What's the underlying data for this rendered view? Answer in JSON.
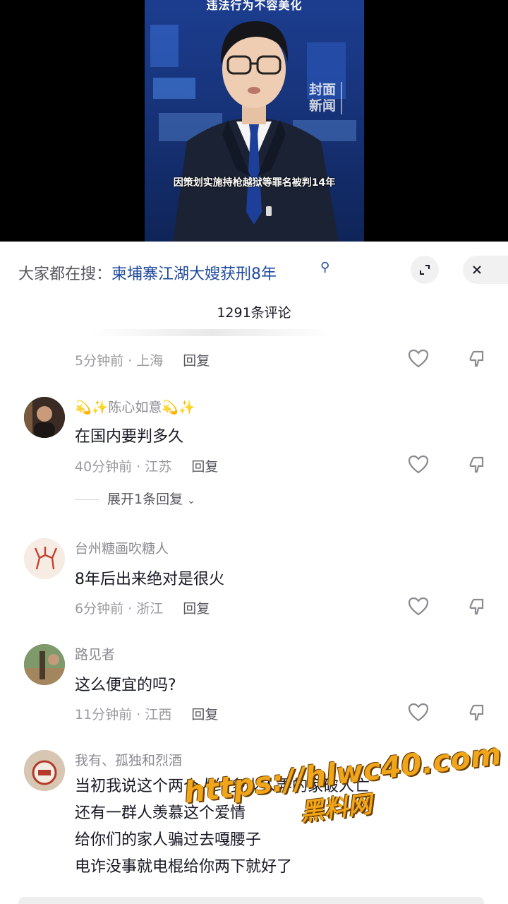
{
  "video": {
    "caption_top": "违法行为不容美化",
    "caption_bottom": "因策划实施持枪越狱等罪名被判14年",
    "logo_text": "封面新闻"
  },
  "search": {
    "prefix": "大家都在搜：",
    "query": "柬埔寨江湖大嫂获刑8年",
    "icon": "search-icon"
  },
  "header": {
    "comment_count": "1291条评论",
    "expand_icon": "expand-icon",
    "close_icon": "close-icon"
  },
  "first_partial": {
    "time": "5分钟前",
    "location": "上海",
    "reply": "回复"
  },
  "comments": [
    {
      "username": "💫✨陈心如意💫✨",
      "text": "在国内要判多久",
      "time": "40分钟前",
      "location": "江苏",
      "reply": "回复",
      "expand": "展开1条回复",
      "avatar_color": "#3a2b24"
    },
    {
      "username": "台州糖画吹糖人",
      "text": "8年后出来绝对是很火",
      "time": "6分钟前",
      "location": "浙江",
      "reply": "回复",
      "avatar_color": "#f3e7dc"
    },
    {
      "username": "路见者",
      "text": "这么便宜的吗?",
      "time": "11分钟前",
      "location": "江西",
      "reply": "回复",
      "avatar_color": "#6d8a5c"
    },
    {
      "username": "我有、孤独和烈酒",
      "lines": [
        "当初我说这个两个人给多少人弄的家破人亡",
        "还有一群人羡慕这个爱情",
        "给你们的家人骗过去嘎腰子",
        "电诈没事就电棍给你两下就好了"
      ],
      "avatar_color": "#c9b9a6"
    }
  ],
  "watermark": {
    "url": "https://hlwc40.com",
    "name": "黑料网"
  },
  "colors": {
    "link": "#1f4a9c",
    "meta": "#9a9aa0",
    "watermark": "#f0a51a"
  }
}
